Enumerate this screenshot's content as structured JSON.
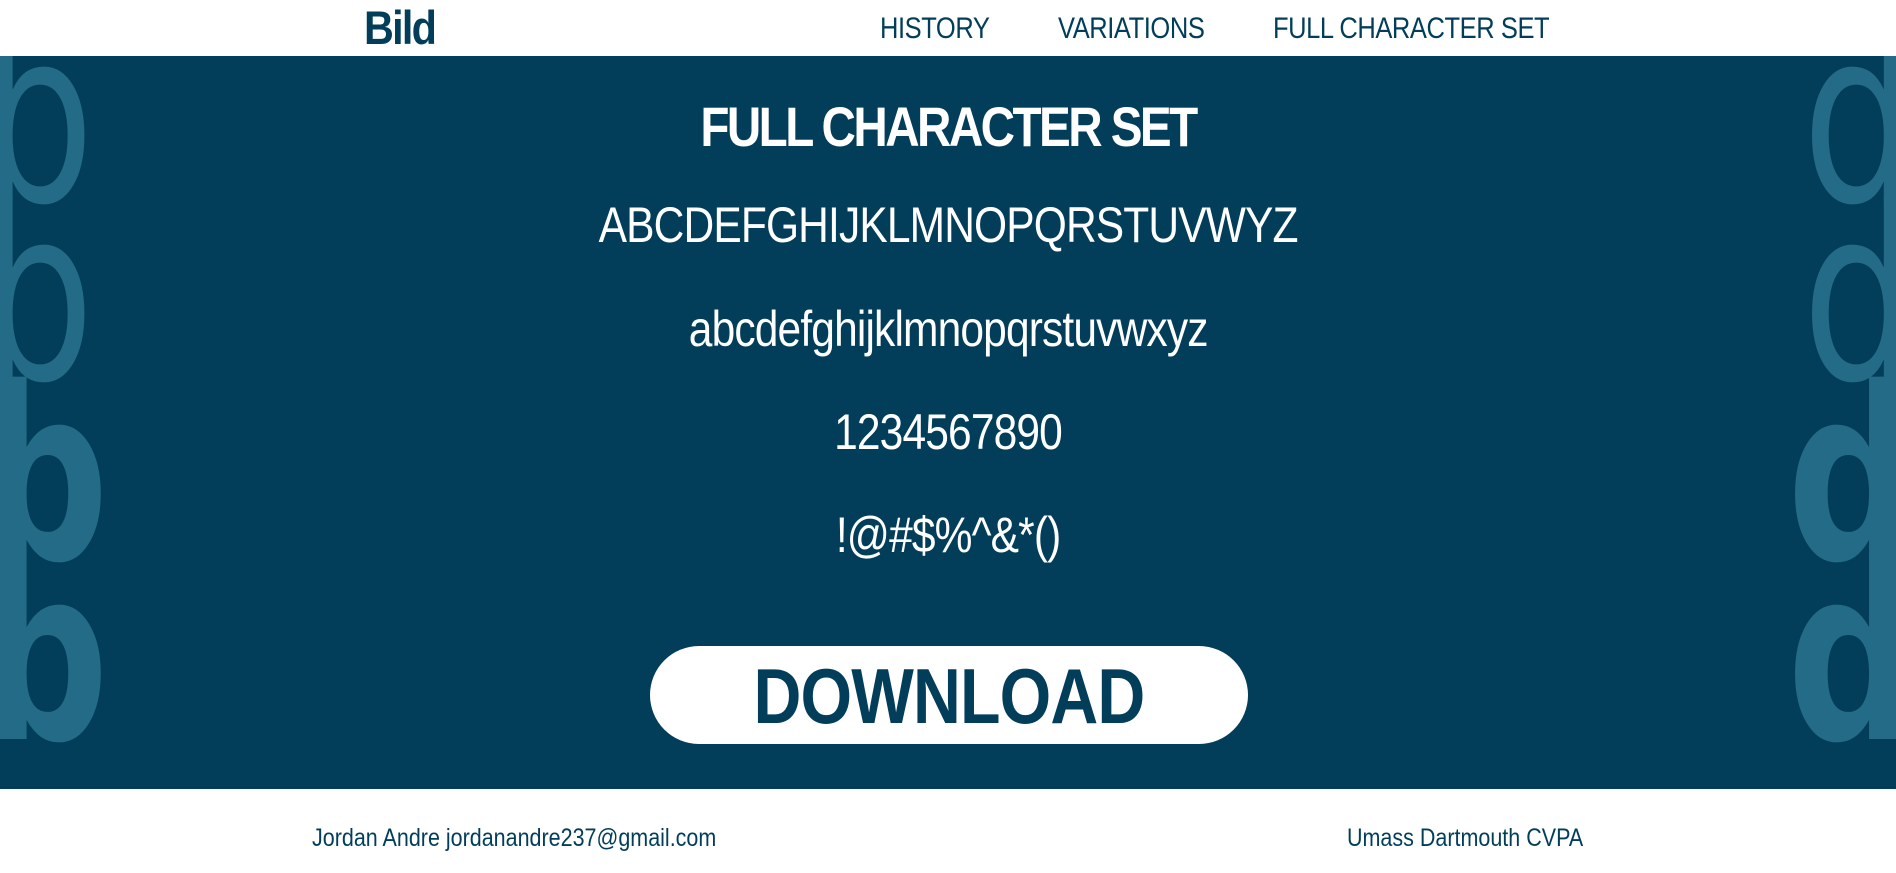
{
  "header": {
    "logo": "Bild",
    "nav": {
      "history": "HISTORY",
      "variations": "VARIATIONS",
      "full_character_set": "FULL CHARACTER SET"
    }
  },
  "main": {
    "title": "FULL CHARACTER SET",
    "uppercase": "ABCDEFGHIJKLMNOPQRSTUVWYZ",
    "lowercase": "abcdefghijklmnopqrstuvwxyz",
    "numbers": "1234567890",
    "symbols": "!@#$%^&*()",
    "download_label": "DOWNLOAD",
    "decoration_left": "b",
    "decoration_right": "d"
  },
  "footer": {
    "author": "Jordan Andre jordanandre237@gmail.com",
    "institution": "Umass Dartmouth CVPA"
  },
  "colors": {
    "primary": "#023e5a",
    "decoration": "#236b86",
    "background": "#ffffff"
  }
}
